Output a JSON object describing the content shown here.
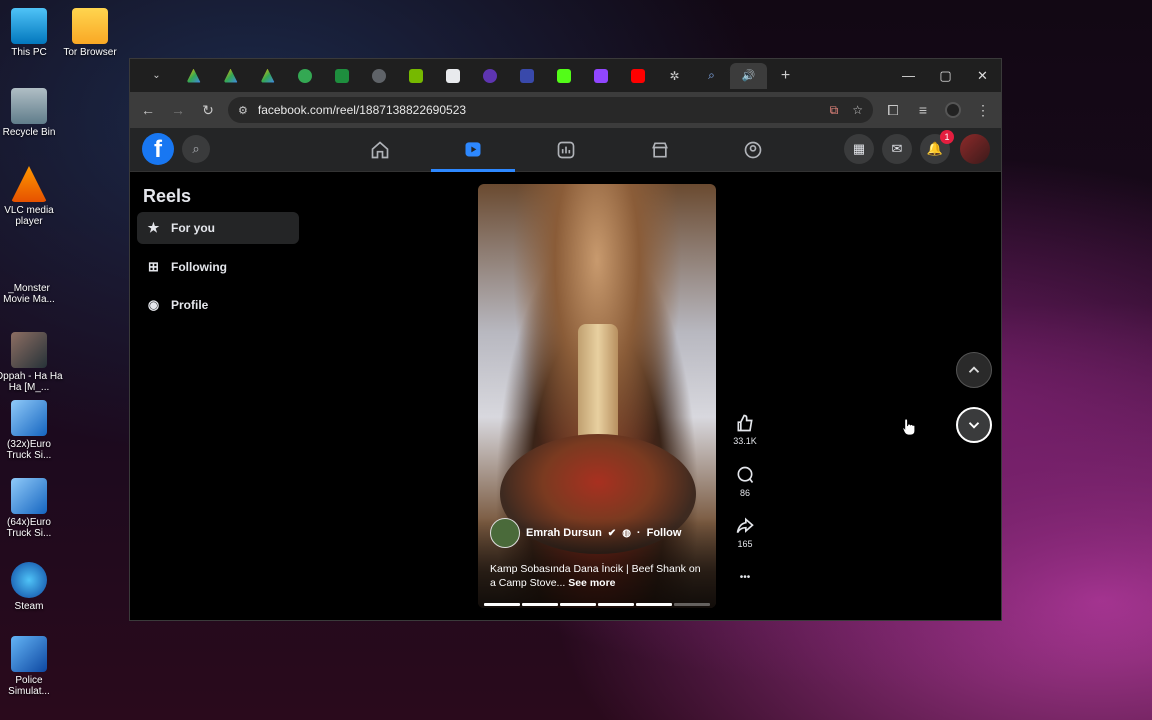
{
  "desktop": {
    "icons": [
      {
        "label": "This PC"
      },
      {
        "label": "Tor Browser"
      },
      {
        "label": "Recycle Bin"
      },
      {
        "label": "VLC media player"
      },
      {
        "label": "_Monster Movie Ma..."
      },
      {
        "label": "Oppah - Ha Ha Ha [M_..."
      },
      {
        "label": "(32x)Euro Truck Si..."
      },
      {
        "label": "(64x)Euro Truck Si..."
      },
      {
        "label": "Steam"
      },
      {
        "label": "Police Simulat..."
      }
    ]
  },
  "browser": {
    "url": "facebook.com/reel/1887138822690523",
    "new_tab_symbol": "+",
    "window_controls": {
      "minimize": "—",
      "maximize": "▢",
      "close": "✕"
    }
  },
  "facebook": {
    "logo_letter": "f",
    "notification_count": "1",
    "accent_color": "#1877f2"
  },
  "reels": {
    "title": "Reels",
    "sidebar": [
      {
        "label": "For you",
        "icon": "star-icon",
        "active": true
      },
      {
        "label": "Following",
        "icon": "following-icon",
        "active": false
      },
      {
        "label": "Profile",
        "icon": "profile-icon",
        "active": false
      }
    ],
    "video": {
      "author": "Emrah Dursun",
      "follow_label": "Follow",
      "caption": "Kamp Sobasında Dana İncik | Beef Shank on a Camp Stove...",
      "see_more": "See more"
    },
    "actions": {
      "likes": "33.1K",
      "comments": "86",
      "shares": "165",
      "more": "•••"
    }
  }
}
